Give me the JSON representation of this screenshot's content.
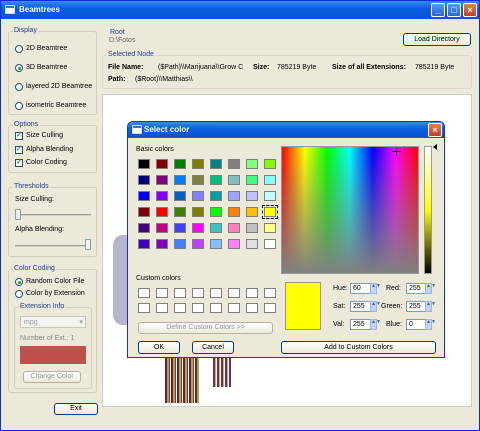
{
  "window": {
    "title": "Beamtrees"
  },
  "display": {
    "group_label": "Display",
    "options": [
      {
        "label": "2D Beamtree",
        "selected": false
      },
      {
        "label": "3D Beamtree",
        "selected": true
      },
      {
        "label": "layered 2D Beamtree",
        "selected": false
      },
      {
        "label": "isometric Beamtree",
        "selected": false
      }
    ]
  },
  "options_group": {
    "group_label": "Options",
    "items": [
      {
        "label": "Size Culling",
        "checked": true
      },
      {
        "label": "Alpha Blending",
        "checked": true
      },
      {
        "label": "Color Coding",
        "checked": true
      }
    ]
  },
  "thresholds": {
    "group_label": "Thresholds",
    "size_culling_label": "Size Culling:",
    "size_culling_level": 0.0,
    "alpha_label": "Alpha Blending:",
    "alpha_level": 1.0
  },
  "color_coding": {
    "group_label": "Color Coding",
    "options": [
      {
        "label": "Random Color File",
        "selected": true
      },
      {
        "label": "Color by Extension",
        "selected": false
      }
    ],
    "ext_group_label": "Extension Info",
    "ext_combo_value": "mpg",
    "ext_count_text": "Number of Ext.: 1",
    "swatch_color": "#c0504d",
    "change_color_label": "Change Color"
  },
  "exit_label": "Exit",
  "root": {
    "group_label": "Root",
    "path": "D:\\Fotos",
    "load_button": "Load Directory"
  },
  "selected_node": {
    "group_label": "Selected Node",
    "file_name_label": "File Name:",
    "file_name_value": "($Path)\\\\Marijuana\\\\Grow C",
    "size_label": "Size:",
    "size_value": "785219 Byte",
    "ext_size_label": "Size of all Extensions:",
    "ext_size_value": "785219 Byte",
    "path_label": "Path:",
    "path_value": "($Root)\\\\Matthias\\\\"
  },
  "dialog": {
    "title": "Select color",
    "basic_colors_label": "Basic colors",
    "basic_colors": [
      [
        "#000000",
        "#800000",
        "#008000",
        "#808000",
        "#008080",
        "#808080",
        "#80ff80",
        "#80ff00"
      ],
      [
        "#000080",
        "#800080",
        "#0080ff",
        "#808040",
        "#00c080",
        "#80c0c0",
        "#40ff80",
        "#80ffff"
      ],
      [
        "#0000ff",
        "#8000ff",
        "#0060c0",
        "#8080ff",
        "#00a0a0",
        "#a0a0ff",
        "#c0c0ff",
        "#c0ffff"
      ],
      [
        "#800000",
        "#ff0000",
        "#408000",
        "#808000",
        "#00ff00",
        "#ff8000",
        "#ffc000",
        "#ffff00"
      ],
      [
        "#400080",
        "#c00080",
        "#4040ff",
        "#ff00ff",
        "#40c0c0",
        "#ff80c0",
        "#c0c0c0",
        "#ffff80"
      ],
      [
        "#4000c0",
        "#8000c0",
        "#4080ff",
        "#c040ff",
        "#80c0ff",
        "#ff80ff",
        "#e0e0e0",
        "#ffffff"
      ]
    ],
    "custom_colors_label": "Custom colors",
    "define_custom_label": "Define Custom Colors >>",
    "ok_label": "OK",
    "cancel_label": "Cancel",
    "add_custom_label": "Add to Custom Colors",
    "preview_color": "#ffff00",
    "hue_label": "Hue:",
    "hue_value": "60",
    "sat_label": "Sat:",
    "sat_value": "255",
    "val_label": "Val:",
    "val_value": "255",
    "red_label": "Red:",
    "red_value": "255",
    "green_label": "Green:",
    "green_value": "255",
    "blue_label": "Blue:",
    "blue_value": "0"
  }
}
